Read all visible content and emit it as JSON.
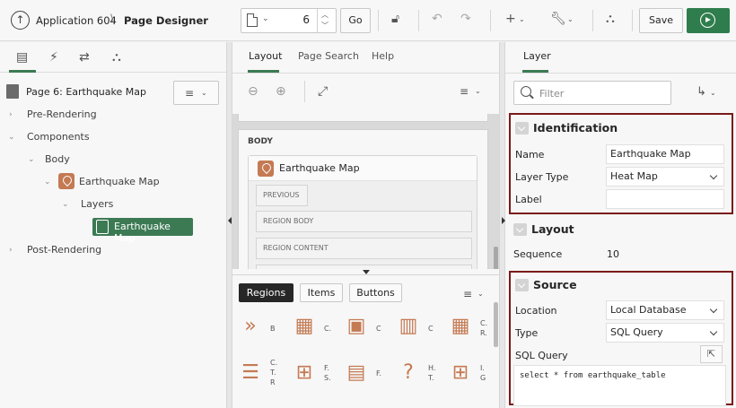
{
  "header": {
    "app_name": "Application 604",
    "separator": "\\",
    "designer_label": "Page Designer",
    "page_number": "6",
    "go_label": "Go",
    "save_label": "Save"
  },
  "left": {
    "page_title": "Page 6: Earthquake Map",
    "tree": {
      "pre_rendering": "Pre-Rendering",
      "components": "Components",
      "body": "Body",
      "region": "Earthquake Map",
      "layers": "Layers",
      "layer": "Earthquake Map",
      "post_rendering": "Post-Rendering"
    }
  },
  "center": {
    "tabs": [
      "Layout",
      "Page Search",
      "Help"
    ],
    "body_label": "BODY",
    "region_title": "Earthquake Map",
    "slots": [
      "PREVIOUS",
      "REGION BODY",
      "REGION CONTENT"
    ],
    "gallery_tabs": [
      "Regions",
      "Items",
      "Buttons"
    ],
    "gallery_items": [
      {
        "icon": "breadcrumb-icon",
        "label": "B"
      },
      {
        "icon": "calendar-icon",
        "label": "C."
      },
      {
        "icon": "card-icon",
        "label": "C"
      },
      {
        "icon": "chart-icon",
        "label": "C"
      },
      {
        "icon": "classic-report-icon",
        "label": "C. R."
      },
      {
        "icon": "content-row-icon",
        "label": "C. T. R"
      },
      {
        "icon": "faceted-search-icon",
        "label": "F. S."
      },
      {
        "icon": "form-icon",
        "label": "F."
      },
      {
        "icon": "help-text-icon",
        "label": "H. T."
      },
      {
        "icon": "interactive-grid-icon",
        "label": "I. G"
      }
    ]
  },
  "right": {
    "tab": "Layer",
    "filter_placeholder": "Filter",
    "identification": {
      "title": "Identification",
      "name_label": "Name",
      "name_value": "Earthquake Map",
      "layer_type_label": "Layer Type",
      "layer_type_value": "Heat Map",
      "label_label": "Label",
      "label_value": ""
    },
    "layout": {
      "title": "Layout",
      "sequence_label": "Sequence",
      "sequence_value": "10"
    },
    "source": {
      "title": "Source",
      "location_label": "Location",
      "location_value": "Local Database",
      "type_label": "Type",
      "type_value": "SQL Query",
      "sql_label": "SQL Query",
      "sql_value": "select * from earthquake_table"
    }
  },
  "colors": {
    "accent": "#3c7a54",
    "region_icon": "#c47a53",
    "highlight_border": "#7a1a1a",
    "run_button": "#2f7d4d"
  }
}
